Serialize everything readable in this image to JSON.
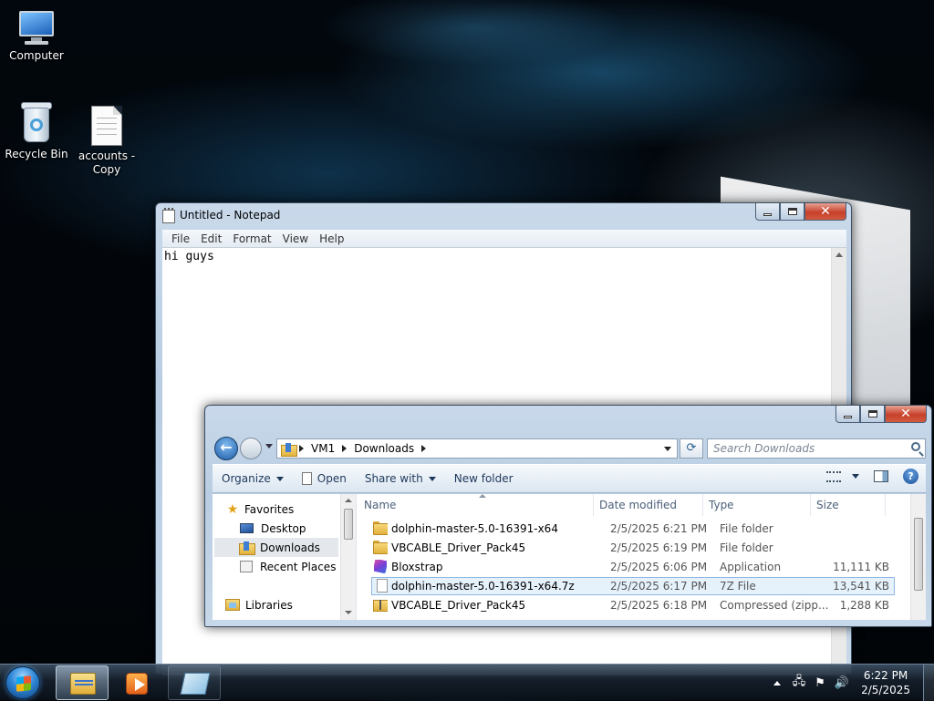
{
  "desktop": {
    "icons": [
      {
        "label": "Computer",
        "icon": "computer-icon"
      },
      {
        "label": "Recycle Bin",
        "icon": "recycle-bin-icon"
      },
      {
        "label": "accounts - Copy",
        "icon": "text-file-icon"
      }
    ]
  },
  "notepad": {
    "title": "Untitled - Notepad",
    "menu": [
      "File",
      "Edit",
      "Format",
      "View",
      "Help"
    ],
    "content": "hi guys"
  },
  "explorer": {
    "address": [
      "VM1",
      "Downloads"
    ],
    "search_placeholder": "Search Downloads",
    "toolbar": {
      "organize": "Organize",
      "open": "Open",
      "share_with": "Share with",
      "new_folder": "New folder"
    },
    "nav": {
      "favorites": "Favorites",
      "desktop": "Desktop",
      "downloads": "Downloads",
      "recent_places": "Recent Places",
      "libraries": "Libraries"
    },
    "columns": {
      "name": "Name",
      "date_modified": "Date modified",
      "type": "Type",
      "size": "Size"
    },
    "files": [
      {
        "name": "dolphin-master-5.0-16391-x64",
        "date": "2/5/2025 6:21 PM",
        "type": "File folder",
        "size": "",
        "icon": "folder-icon",
        "selected": false
      },
      {
        "name": "VBCABLE_Driver_Pack45",
        "date": "2/5/2025 6:19 PM",
        "type": "File folder",
        "size": "",
        "icon": "folder-icon",
        "selected": false
      },
      {
        "name": "Bloxstrap",
        "date": "2/5/2025 6:06 PM",
        "type": "Application",
        "size": "11,111 KB",
        "icon": "app-icon",
        "selected": false
      },
      {
        "name": "dolphin-master-5.0-16391-x64.7z",
        "date": "2/5/2025 6:17 PM",
        "type": "7Z File",
        "size": "13,541 KB",
        "icon": "file-icon",
        "selected": true
      },
      {
        "name": "VBCABLE_Driver_Pack45",
        "date": "2/5/2025 6:18 PM",
        "type": "Compressed (zipp...",
        "size": "1,288 KB",
        "icon": "zip-folder-icon",
        "selected": false
      }
    ]
  },
  "taskbar": {
    "clock_time": "6:22 PM",
    "clock_date": "2/5/2025"
  },
  "colors": {
    "selection": "#e5f1fb",
    "close_button": "#c7402a",
    "accent": "#1d5ea8"
  }
}
